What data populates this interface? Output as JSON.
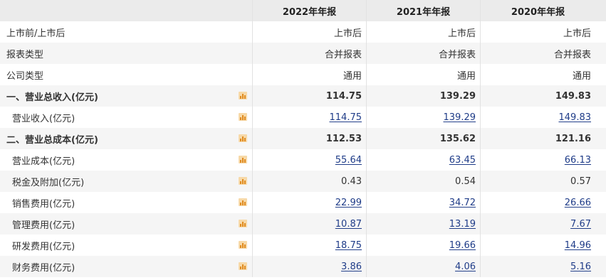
{
  "columns": [
    "2022年年报",
    "2021年年报",
    "2020年年报"
  ],
  "rows": [
    {
      "label": "上市前/上市后",
      "values": [
        "上市后",
        "上市后",
        "上市后"
      ],
      "bold": false,
      "sub": false,
      "chart": false,
      "link": false
    },
    {
      "label": "报表类型",
      "values": [
        "合并报表",
        "合并报表",
        "合并报表"
      ],
      "bold": false,
      "sub": false,
      "chart": false,
      "link": false
    },
    {
      "label": "公司类型",
      "values": [
        "通用",
        "通用",
        "通用"
      ],
      "bold": false,
      "sub": false,
      "chart": false,
      "link": false
    },
    {
      "label": "一、营业总收入(亿元)",
      "values": [
        "114.75",
        "139.29",
        "149.83"
      ],
      "bold": true,
      "sub": false,
      "chart": true,
      "link": false
    },
    {
      "label": "营业收入(亿元)",
      "values": [
        "114.75",
        "139.29",
        "149.83"
      ],
      "bold": false,
      "sub": true,
      "chart": true,
      "link": true
    },
    {
      "label": "二、营业总成本(亿元)",
      "values": [
        "112.53",
        "135.62",
        "121.16"
      ],
      "bold": true,
      "sub": false,
      "chart": true,
      "link": false
    },
    {
      "label": "营业成本(亿元)",
      "values": [
        "55.64",
        "63.45",
        "66.13"
      ],
      "bold": false,
      "sub": true,
      "chart": true,
      "link": true
    },
    {
      "label": "税金及附加(亿元)",
      "values": [
        "0.43",
        "0.54",
        "0.57"
      ],
      "bold": false,
      "sub": true,
      "chart": true,
      "link": false
    },
    {
      "label": "销售费用(亿元)",
      "values": [
        "22.99",
        "34.72",
        "26.66"
      ],
      "bold": false,
      "sub": true,
      "chart": true,
      "link": true
    },
    {
      "label": "管理费用(亿元)",
      "values": [
        "10.87",
        "13.19",
        "7.67"
      ],
      "bold": false,
      "sub": true,
      "chart": true,
      "link": true
    },
    {
      "label": "研发费用(亿元)",
      "values": [
        "18.75",
        "19.66",
        "14.96"
      ],
      "bold": false,
      "sub": true,
      "chart": true,
      "link": true
    },
    {
      "label": "财务费用(亿元)",
      "values": [
        "3.86",
        "4.06",
        "5.16"
      ],
      "bold": false,
      "sub": true,
      "chart": true,
      "link": true
    }
  ],
  "icons": {
    "chart": "bar-chart-icon"
  },
  "colors": {
    "header_bg": "#ebebeb",
    "alt_row_bg": "#f5f5f5",
    "link": "#1f3c88",
    "icon": "#e08a1e"
  }
}
